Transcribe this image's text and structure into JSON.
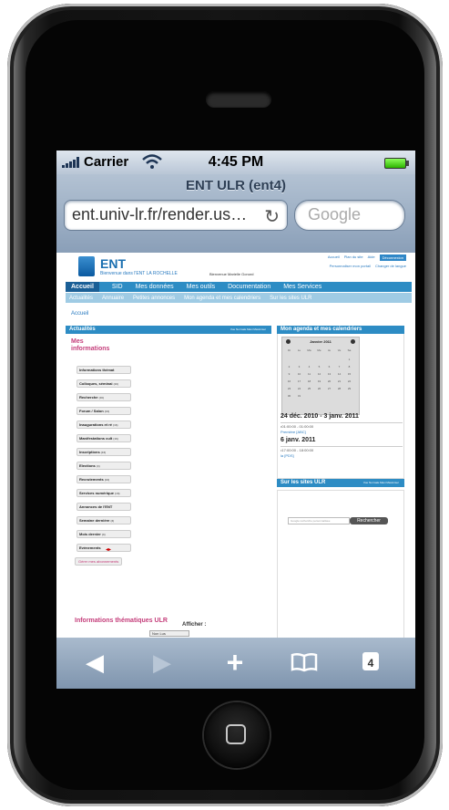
{
  "status_bar": {
    "carrier": "Carrier",
    "time": "4:45 PM"
  },
  "browser": {
    "title": "ENT ULR (ent4)",
    "url": "ent.univ-lr.fr/render.us…",
    "search_placeholder": "Google"
  },
  "site": {
    "brand": "ENT",
    "welcome": "Bienvenue dans l'ENT  LA ROCHELLE",
    "user": "Bienvenue Marielle Gonord",
    "top_links": [
      "Accueil",
      "Plan du site",
      "Aide",
      "Déconnexion"
    ],
    "top_links2": [
      "Personnaliser mon portail",
      "Changer de langue"
    ],
    "nav_main": [
      "Accueil",
      "SID",
      "Mes données",
      "Mes outils",
      "Documentation",
      "Mes Services"
    ],
    "nav_sub": [
      "Actualités",
      "Annuaire",
      "Petites annonces",
      "Mon agenda et mes calendriers",
      "Sur les sites ULR"
    ],
    "breadcrumb": "Accueil",
    "actualites": {
      "title": "Actualités",
      "tools": "Vue Normale Maxi  Maximiser",
      "section_title": "Mes informations",
      "tree": [
        {
          "label": "Informations thémat",
          "count": ""
        },
        {
          "label": "Colloques, séminai",
          "count": "(16)"
        },
        {
          "label": "Recherche",
          "count": "(16)"
        },
        {
          "label": "Forum / Salon",
          "count": "(16)"
        },
        {
          "label": "Inaugurations et ré",
          "count": "(16)"
        },
        {
          "label": "Manifestations cult",
          "count": "(16)"
        },
        {
          "label": "Inscriptions",
          "count": "(16)"
        },
        {
          "label": "Elections",
          "count": "(4)"
        },
        {
          "label": "Recrutements",
          "count": "(16)"
        },
        {
          "label": "Services numérique",
          "count": "(16)"
        },
        {
          "label": "Annonces de l'ENT",
          "count": ""
        },
        {
          "label": "Semaine dernière",
          "count": "(3)"
        },
        {
          "label": "Mois dernier",
          "count": "(3)"
        },
        {
          "label": "Evènements",
          "count": ""
        }
      ],
      "manage_button": "Gérer mes abonnements",
      "info_title": "Informations thématiques ULR",
      "display_label": "Afficher :",
      "display_value": "Non Lus"
    },
    "agenda": {
      "title": "Mon agenda et mes calendriers",
      "month": "Janvier 2011",
      "weekdays": [
        "Di",
        "Lu",
        "Ma",
        "Me",
        "Je",
        "Ve",
        "Sa"
      ],
      "weeks": [
        [
          "",
          "",
          "",
          "",
          "",
          "",
          "1"
        ],
        [
          "2",
          "3",
          "4",
          "5",
          "6",
          "7",
          "8"
        ],
        [
          "9",
          "10",
          "11",
          "12",
          "13",
          "14",
          "15"
        ],
        [
          "16",
          "17",
          "18",
          "19",
          "20",
          "21",
          "22"
        ],
        [
          "23",
          "24",
          "25",
          "26",
          "27",
          "28",
          "29"
        ],
        [
          "30",
          "31",
          "",
          "",
          "",
          "",
          ""
        ]
      ],
      "range1": "24 déc. 2010 - 3 janv. 2011",
      "event1_time": "01:00:00 - 01:00:00",
      "event1_name": "Première [ABC]",
      "range2": "6 janv. 2011",
      "event2_time": "17:00:00 - 18:00:00",
      "event2_name": "la [PDS]"
    },
    "sites": {
      "title": "Sur les sites ULR",
      "tools": "Vue Normale Maxi  Maximiser",
      "search_placeholder": "Google recherche personnalisée",
      "search_button": "Rechercher"
    }
  },
  "colors": {
    "nav_blue": "#2d8cc4",
    "pink": "#c43d7a",
    "toolbar": "#8a9fb8"
  }
}
